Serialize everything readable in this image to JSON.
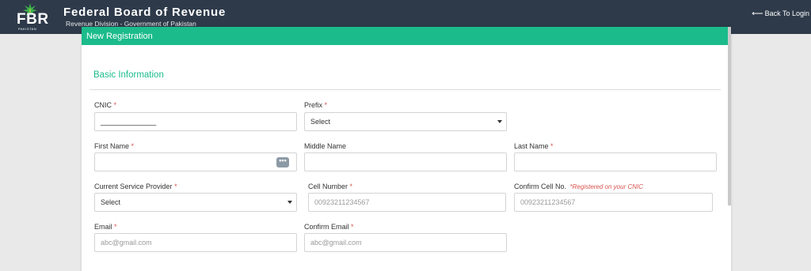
{
  "header": {
    "logo_text": "FBR",
    "logo_sub": "PAKISTAN",
    "title": "Federal Board of Revenue",
    "subtitle": "Revenue Division - Government of Pakistan",
    "back_label": "Back To Login"
  },
  "panel": {
    "title": "New Registration",
    "section": "Basic Information"
  },
  "form": {
    "cnic": {
      "label": "CNIC",
      "value": "______________"
    },
    "prefix": {
      "label": "Prefix",
      "value": "Select"
    },
    "first_name": {
      "label": "First Name",
      "value": ""
    },
    "middle_name": {
      "label": "Middle Name",
      "value": ""
    },
    "last_name": {
      "label": "Last Name",
      "value": ""
    },
    "service_provider": {
      "label": "Current Service Provider",
      "value": "Select"
    },
    "cell_number": {
      "label": "Cell Number",
      "placeholder": "00923211234567"
    },
    "confirm_cell": {
      "label": "Confirm Cell No.",
      "note": "*Registered on your CNIC",
      "placeholder": "00923211234567"
    },
    "email": {
      "label": "Email",
      "placeholder": "abc@gmail.com"
    },
    "confirm_email": {
      "label": "Confirm Email",
      "placeholder": "abc@gmail.com"
    },
    "required_mark": "*",
    "dots": "•••"
  },
  "colors": {
    "header_bg": "#2e3a4a",
    "accent": "#1cbb8c",
    "required": "#d9534f"
  },
  "icons": {
    "back": "arrow-left-icon",
    "caret": "caret-down-icon",
    "more": "more-dots-icon"
  }
}
